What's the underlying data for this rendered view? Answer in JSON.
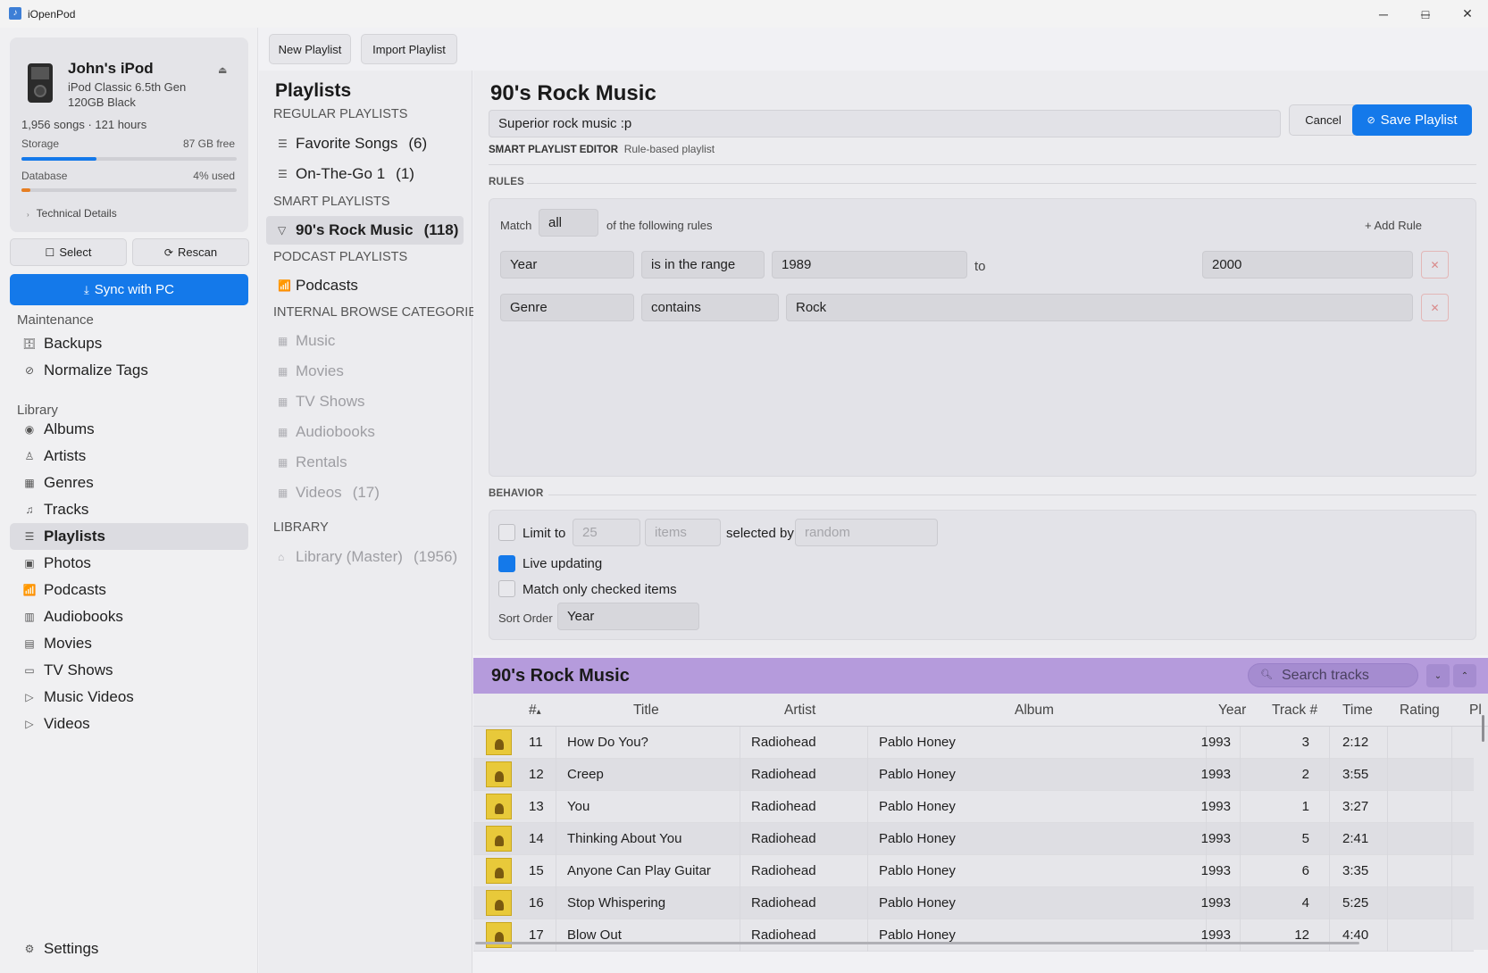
{
  "window": {
    "title": "iOpenPod",
    "controls": {
      "minimize": "─",
      "maximize": "□",
      "close": "✕"
    }
  },
  "device": {
    "name": "John's iPod",
    "model": "iPod Classic 6.5th Gen",
    "capacity": "120GB Black",
    "stats": "1,956 songs · 121 hours",
    "storage_label": "Storage",
    "storage_free": "87 GB free",
    "storage_used_fraction": 0.35,
    "database_label": "Database",
    "database_used": "4% used",
    "database_used_fraction": 0.04,
    "technical_details": "Technical Details",
    "eject_glyph": "⏏"
  },
  "actions": {
    "select_label": "Select",
    "rescan_label": "Rescan",
    "sync_label": "Sync with PC"
  },
  "maintenance": {
    "heading": "Maintenance",
    "items": [
      {
        "label": "Backups",
        "icon": "backups-icon",
        "glyph": "🗄"
      },
      {
        "label": "Normalize Tags",
        "icon": "normalize-icon",
        "glyph": "⊘"
      }
    ]
  },
  "library_nav": {
    "heading": "Library",
    "items": [
      {
        "label": "Albums",
        "icon": "albums-icon",
        "glyph": "◉"
      },
      {
        "label": "Artists",
        "icon": "artists-icon",
        "glyph": "♙"
      },
      {
        "label": "Genres",
        "icon": "genres-icon",
        "glyph": "▦"
      },
      {
        "label": "Tracks",
        "icon": "tracks-icon",
        "glyph": "♫"
      },
      {
        "label": "Playlists",
        "icon": "playlists-icon",
        "glyph": "☰",
        "active": true
      },
      {
        "label": "Photos",
        "icon": "photos-icon",
        "glyph": "▣"
      },
      {
        "label": "Podcasts",
        "icon": "podcasts-icon",
        "glyph": "📶"
      },
      {
        "label": "Audiobooks",
        "icon": "audiobooks-icon",
        "glyph": "▥"
      },
      {
        "label": "Movies",
        "icon": "movies-icon",
        "glyph": "▤"
      },
      {
        "label": "TV Shows",
        "icon": "tv-icon",
        "glyph": "▭"
      },
      {
        "label": "Music Videos",
        "icon": "music-videos-icon",
        "glyph": "▷"
      },
      {
        "label": "Videos",
        "icon": "videos-icon",
        "glyph": "▷"
      }
    ],
    "settings_label": "Settings"
  },
  "toolbar": {
    "new_playlist": "New Playlist",
    "import_playlist": "Import Playlist"
  },
  "playlists": {
    "title": "Playlists",
    "regular_heading": "REGULAR PLAYLISTS",
    "regular": [
      {
        "label": "Favorite Songs",
        "count": "(6)"
      },
      {
        "label": "On-The-Go 1",
        "count": "(1)"
      }
    ],
    "smart_heading": "SMART PLAYLISTS",
    "smart": [
      {
        "label": "90's Rock Music",
        "count": "(118)"
      }
    ],
    "podcast_heading": "PODCAST PLAYLISTS",
    "podcast": [
      {
        "label": "Podcasts"
      }
    ],
    "internal_heading": "INTERNAL BROWSE CATEGORIE",
    "internal": [
      {
        "label": "Music",
        "count": ""
      },
      {
        "label": "Movies",
        "count": ""
      },
      {
        "label": "TV Shows",
        "count": ""
      },
      {
        "label": "Audiobooks",
        "count": ""
      },
      {
        "label": "Rentals",
        "count": ""
      },
      {
        "label": "Videos",
        "count": "(17)"
      }
    ],
    "library_heading": "LIBRARY",
    "library": [
      {
        "label": "Library (Master)",
        "count": "(1956)"
      }
    ]
  },
  "editor": {
    "title": "90's Rock Music",
    "description": "Superior rock music :p",
    "cancel_label": "Cancel",
    "save_label": "Save Playlist",
    "subtitle_strong": "SMART PLAYLIST EDITOR",
    "subtitle": "Rule-based playlist",
    "rules_caption": "RULES",
    "match_label": "Match",
    "match_value": "all",
    "match_suffix": "of the following rules",
    "add_rule_label": "+ Add Rule",
    "rules": [
      {
        "field": "Year",
        "op": "is in the range",
        "value": "1989",
        "to_label": "to",
        "value2": "2000"
      },
      {
        "field": "Genre",
        "op": "contains",
        "value": "Rock"
      }
    ],
    "remove_glyph": "✕",
    "behavior_caption": "BEHAVIOR",
    "limit_label": "Limit to",
    "limit_count_placeholder": "25",
    "limit_unit_placeholder": "items",
    "selected_by_label": "selected by",
    "selected_by_placeholder": "random",
    "limit_enabled": false,
    "live_updating_label": "Live updating",
    "live_updating": true,
    "checked_only_label": "Match only checked items",
    "checked_only": false,
    "sort_order_label": "Sort Order",
    "sort_order_value": "Year"
  },
  "tracks": {
    "title": "90's Rock Music",
    "search_placeholder": "Search tracks",
    "columns": [
      "#",
      "Title",
      "Artist",
      "Album",
      "Year",
      "Track #",
      "Time",
      "Rating",
      "Pl"
    ],
    "sort_indicator": "▴",
    "rows": [
      {
        "num": "11",
        "title": "How Do You?",
        "artist": "Radiohead",
        "album": "Pablo Honey",
        "year": "1993",
        "track": "3",
        "time": "2:12"
      },
      {
        "num": "12",
        "title": "Creep",
        "artist": "Radiohead",
        "album": "Pablo Honey",
        "year": "1993",
        "track": "2",
        "time": "3:55"
      },
      {
        "num": "13",
        "title": "You",
        "artist": "Radiohead",
        "album": "Pablo Honey",
        "year": "1993",
        "track": "1",
        "time": "3:27"
      },
      {
        "num": "14",
        "title": "Thinking About You",
        "artist": "Radiohead",
        "album": "Pablo Honey",
        "year": "1993",
        "track": "5",
        "time": "2:41"
      },
      {
        "num": "15",
        "title": "Anyone Can Play Guitar",
        "artist": "Radiohead",
        "album": "Pablo Honey",
        "year": "1993",
        "track": "6",
        "time": "3:35"
      },
      {
        "num": "16",
        "title": "Stop Whispering",
        "artist": "Radiohead",
        "album": "Pablo Honey",
        "year": "1993",
        "track": "4",
        "time": "5:25"
      },
      {
        "num": "17",
        "title": "Blow Out",
        "artist": "Radiohead",
        "album": "Pablo Honey",
        "year": "1993",
        "track": "12",
        "time": "4:40"
      }
    ]
  },
  "colors": {
    "accent": "#1479ea",
    "tracks_header": "#b59bdc",
    "storage_bar": "#1479ea",
    "database_bar": "#e67e22"
  }
}
